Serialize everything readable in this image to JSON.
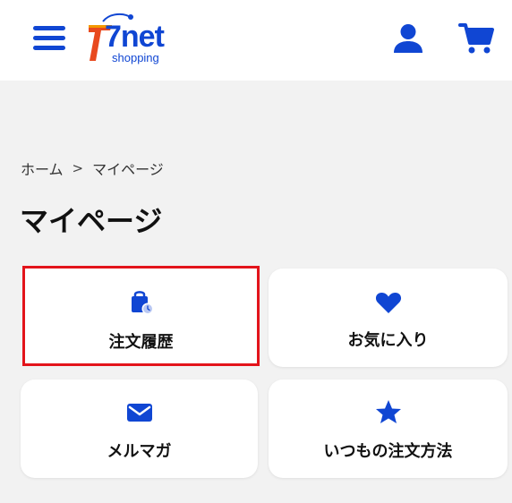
{
  "header": {
    "logo": {
      "brand": "7net",
      "sub": "shopping"
    },
    "icons": {
      "menu": "hamburger-menu-icon",
      "user": "user-icon",
      "cart": "shopping-cart-icon"
    }
  },
  "breadcrumb": {
    "home": "ホーム",
    "separator": ">",
    "current": "マイページ"
  },
  "page_title": "マイページ",
  "cards": {
    "order_history": {
      "label": "注文履歴",
      "icon": "shopping-bag-clock-icon"
    },
    "favorites": {
      "label": "お気に入り",
      "icon": "heart-icon"
    },
    "mail_magazine": {
      "label": "メルマガ",
      "icon": "mail-icon"
    },
    "usual_order": {
      "label": "いつもの注文方法",
      "icon": "star-icon"
    }
  },
  "colors": {
    "accent": "#1046d3",
    "brand_red": "#e8491e",
    "brand_orange": "#f39800",
    "highlight": "#e3141b",
    "background": "#f2f2f2"
  }
}
